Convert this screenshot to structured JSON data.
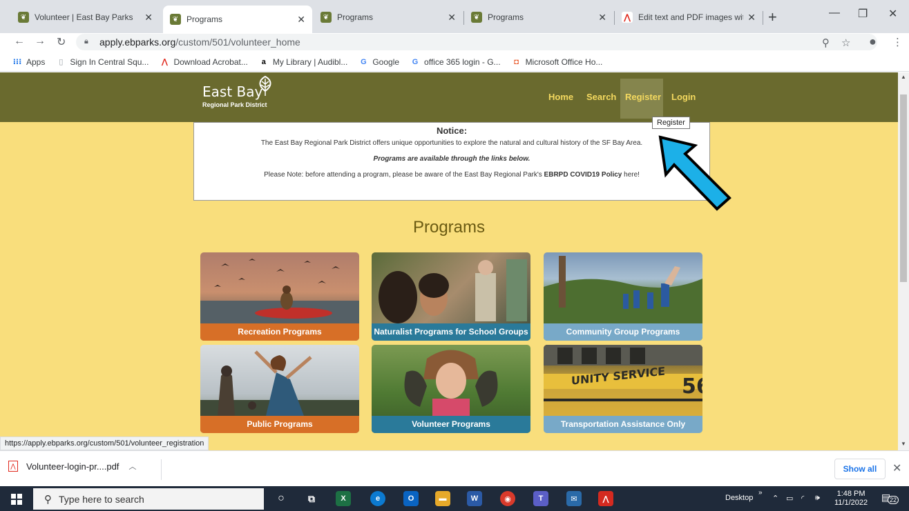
{
  "browser": {
    "tabs": [
      {
        "label": "Volunteer | East Bay Parks",
        "icon": "park-leaf-icon"
      },
      {
        "label": "Programs",
        "icon": "park-leaf-icon",
        "active": true
      },
      {
        "label": "Programs",
        "icon": "park-leaf-icon"
      },
      {
        "label": "Programs",
        "icon": "park-leaf-icon"
      },
      {
        "label": "Edit text and PDF images with",
        "icon": "adobe-icon"
      }
    ],
    "url_host": "apply.ebparks.org",
    "url_path": "/custom/501/volunteer_home",
    "bookmarks": [
      {
        "label": "Apps",
        "icon": "apps-grid-icon"
      },
      {
        "label": "Sign In Central Squ...",
        "icon": "page-icon"
      },
      {
        "label": "Download Acrobat...",
        "icon": "adobe-icon"
      },
      {
        "label": "My Library | Audibl...",
        "icon": "amazon-icon"
      },
      {
        "label": "Google",
        "icon": "google-icon"
      },
      {
        "label": "office 365 login - G...",
        "icon": "google-icon"
      },
      {
        "label": "Microsoft Office Ho...",
        "icon": "office-icon"
      }
    ]
  },
  "site": {
    "logo_line1": "East Bay",
    "logo_line2": "Regional Park District",
    "nav": [
      "Home",
      "Search",
      "Register",
      "Login"
    ],
    "tooltip": "Register",
    "notice": {
      "title": "Notice:",
      "line1": "The East Bay Regional Park District offers unique opportunities to explore the natural and cultural history of the SF Bay Area.",
      "line2": "Programs are available through the links below.",
      "line3_prefix": "Please Note: before attending a program, please be aware of the East Bay Regional Park's ",
      "line3_bold": "EBRPD COVID19 Policy",
      "line3_suffix": " here!"
    },
    "programs_title": "Programs",
    "cards": [
      {
        "label": "Recreation Programs",
        "color": "#d76f27"
      },
      {
        "label": "Naturalist Programs for School Groups",
        "color": "#2a7a9a"
      },
      {
        "label": "Community Group Programs",
        "color": "#78a9c8"
      },
      {
        "label": "Public Programs",
        "color": "#d76f27"
      },
      {
        "label": "Volunteer Programs",
        "color": "#2a7a9a"
      },
      {
        "label": "Transportation Assistance Only",
        "color": "#78a9c8"
      }
    ],
    "accent": "#f9de7c",
    "header_color": "#6a6a2e"
  },
  "status_url": "https://apply.ebparks.org/custom/501/volunteer_registration",
  "download": {
    "filename": "Volunteer-login-pr....pdf",
    "show_all": "Show all"
  },
  "taskbar": {
    "search_placeholder": "Type here to search",
    "desktop_label": "Desktop",
    "time": "1:48 PM",
    "date": "11/1/2022",
    "notifications": "22"
  }
}
